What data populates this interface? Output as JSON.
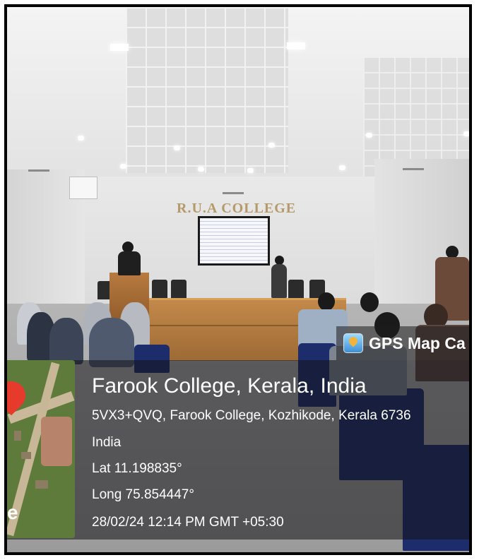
{
  "scene": {
    "college_sign": "R.U.A COLLEGE"
  },
  "overlay": {
    "app_name": "GPS Map Ca",
    "app_icon": "gps-map-camera-icon",
    "place_title": "Farook College, Kerala, India",
    "address_line": "5VX3+QVQ, Farook College, Kozhikode, Kerala 6736",
    "country": "India",
    "latitude": "Lat 11.198835°",
    "longitude": "Long 75.854447°",
    "timestamp": "28/02/24 12:14 PM GMT +05:30",
    "map_edge_letter": "e"
  },
  "colors": {
    "overlay_bg": "#1e1e1e",
    "map_pin": "#e53a2c",
    "sign_gold": "#b59a6a",
    "desk_wood": "#b07540"
  }
}
